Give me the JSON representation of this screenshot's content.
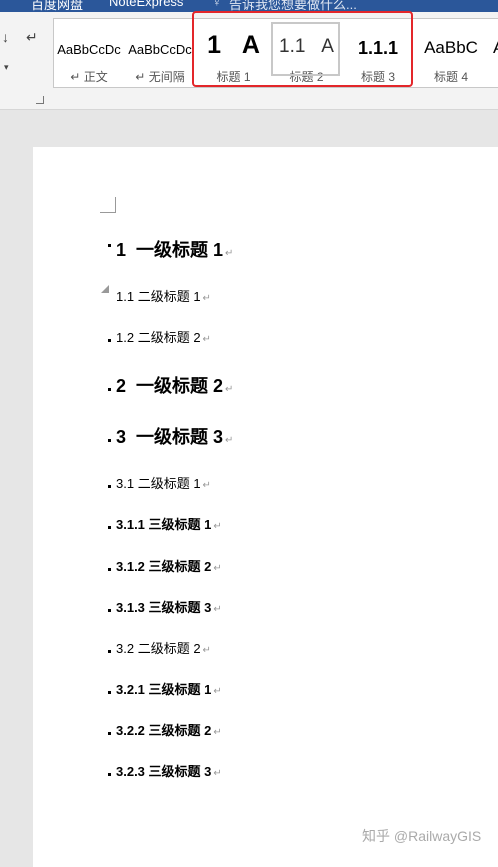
{
  "topbar": {
    "items": [
      "百度网盘",
      "NoteExpress",
      "告诉我您想要做什么..."
    ]
  },
  "ribbon": {
    "styles": [
      {
        "preview": "AaBbCcDc",
        "name": "正文",
        "mark": "↵"
      },
      {
        "preview": "AaBbCcDc",
        "name": "无间隔",
        "mark": "↵"
      },
      {
        "preview_num": "1",
        "preview_letter": "A",
        "name": "标题 1"
      },
      {
        "preview_num": "1.1",
        "preview_letter": "A",
        "name": "标题 2"
      },
      {
        "preview": "1.1.1",
        "name": "标题 3"
      },
      {
        "preview": "AaBbC",
        "name": "标题 4"
      },
      {
        "preview": "A",
        "name": ""
      }
    ]
  },
  "document": {
    "headings": [
      {
        "num": "1",
        "text": "一级标题 1",
        "level": 1
      },
      {
        "num": "1.1",
        "text": "二级标题 1",
        "level": 2
      },
      {
        "num": "1.2",
        "text": "二级标题 2",
        "level": 2
      },
      {
        "num": "2",
        "text": "一级标题 2",
        "level": 1
      },
      {
        "num": "3",
        "text": "一级标题 3",
        "level": 1
      },
      {
        "num": "3.1",
        "text": "二级标题 1",
        "level": 2
      },
      {
        "num": "3.1.1",
        "text": "三级标题 1",
        "level": 3
      },
      {
        "num": "3.1.2",
        "text": "三级标题 2",
        "level": 3
      },
      {
        "num": "3.1.3",
        "text": "三级标题 3",
        "level": 3
      },
      {
        "num": "3.2",
        "text": "二级标题 2",
        "level": 2
      },
      {
        "num": "3.2.1",
        "text": "三级标题 1",
        "level": 3
      },
      {
        "num": "3.2.2",
        "text": "三级标题 2",
        "level": 3
      },
      {
        "num": "3.2.3",
        "text": "三级标题 3",
        "level": 3
      }
    ],
    "para_mark": "↵"
  },
  "watermark": "知乎 @RailwayGIS",
  "colors": {
    "title_bar": "#2b579a",
    "highlight": "#e3262a"
  }
}
